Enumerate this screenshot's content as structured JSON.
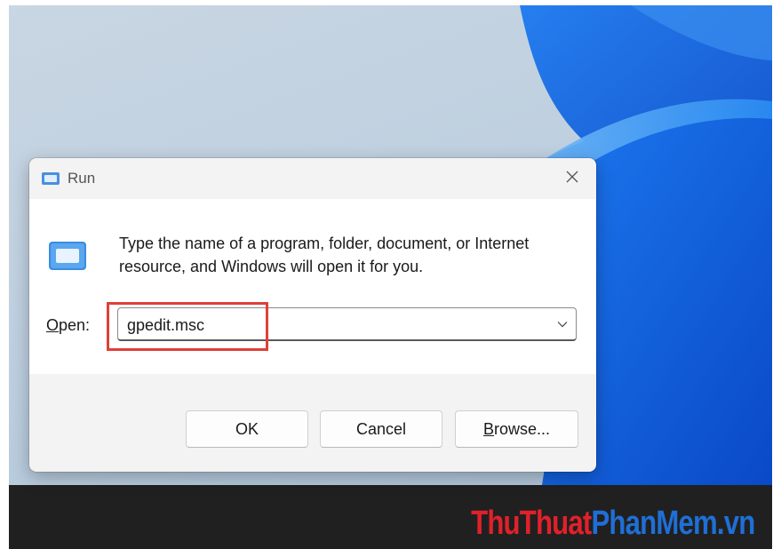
{
  "dialog": {
    "title": "Run",
    "description": "Type the name of a program, folder, document, or Internet resource, and Windows will open it for you.",
    "open_label_first": "O",
    "open_label_rest": "pen:",
    "open_value": "gpedit.msc",
    "buttons": {
      "ok": "OK",
      "cancel": "Cancel",
      "browse_first": "B",
      "browse_rest": "rowse..."
    }
  },
  "watermark": {
    "part_red": "ThuThuat",
    "part_blue": "PhanMem",
    "part_suffix": ".vn"
  },
  "colors": {
    "highlight": "#e0403a",
    "watermark_red": "#e0212a",
    "watermark_blue": "#1f6fd6",
    "taskbar": "#202020"
  },
  "icons": [
    "run-app-icon",
    "close-icon",
    "program-icon",
    "chevron-down-icon"
  ]
}
